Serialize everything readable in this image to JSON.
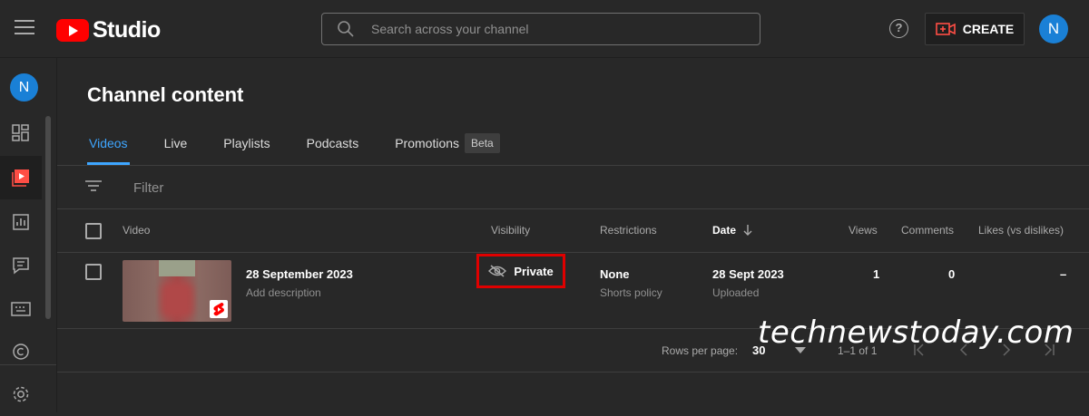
{
  "app": {
    "logo_text": "Studio"
  },
  "search": {
    "placeholder": "Search across your channel"
  },
  "header": {
    "help_symbol": "?",
    "create_label": "CREATE",
    "avatar_initial": "N"
  },
  "sidebar": {
    "avatar_initial": "N"
  },
  "page": {
    "title": "Channel content"
  },
  "tabs": [
    {
      "label": "Videos",
      "active": true
    },
    {
      "label": "Live"
    },
    {
      "label": "Playlists"
    },
    {
      "label": "Podcasts"
    },
    {
      "label": "Promotions",
      "badge": "Beta"
    }
  ],
  "filter": {
    "placeholder": "Filter"
  },
  "table": {
    "headers": {
      "video": "Video",
      "visibility": "Visibility",
      "restrictions": "Restrictions",
      "date": "Date",
      "views": "Views",
      "comments": "Comments",
      "likes": "Likes (vs dislikes)"
    },
    "rows": [
      {
        "title": "28 September 2023",
        "description": "Add description",
        "visibility": "Private",
        "restriction": "None",
        "restriction_sub": "Shorts policy",
        "date": "28 Sept 2023",
        "date_sub": "Uploaded",
        "views": "1",
        "comments": "0",
        "likes": "–"
      }
    ]
  },
  "pagination": {
    "rows_label": "Rows per page:",
    "rows_value": "30",
    "range": "1–1 of 1"
  },
  "watermark": "technewstoday.com",
  "colors": {
    "accent": "#3ea6ff",
    "brand": "#ff0000",
    "highlight": "#e00000",
    "avatar": "#1a80d6"
  },
  "icons": [
    "menu-icon",
    "search-icon",
    "help-icon",
    "create-video-icon",
    "dashboard-icon",
    "content-icon",
    "analytics-icon",
    "comments-icon",
    "subtitles-icon",
    "copyright-icon",
    "settings-icon",
    "filter-icon",
    "hidden-eye-icon",
    "shorts-icon",
    "sort-down-icon",
    "dropdown-icon",
    "first-page-icon",
    "prev-page-icon",
    "next-page-icon",
    "last-page-icon"
  ]
}
